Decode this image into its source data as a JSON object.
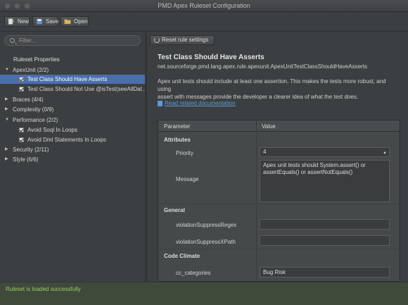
{
  "window": {
    "title": "PMD Apex Ruleset Configuration"
  },
  "toolbar": {
    "new_label": "New",
    "save_label": "Save",
    "open_label": "Open"
  },
  "sidebar": {
    "filter_placeholder": "Filter...",
    "tree_header": "Ruleset Properties",
    "items": [
      {
        "label": "ApexUnit (2/2)",
        "expanded": true
      },
      {
        "label": "Test Class Should Have Asserts",
        "checked": true,
        "selected": true
      },
      {
        "label": "Test Class Should Not Use @isTest(seeAllDat…",
        "checked": true
      },
      {
        "label": "Braces (4/4)",
        "expanded": false
      },
      {
        "label": "Complexity (0/9)",
        "expanded": false
      },
      {
        "label": "Performance (2/2)",
        "expanded": true
      },
      {
        "label": "Avoid Soql In Loops",
        "checked": true
      },
      {
        "label": "Avoid Dml Statements In Loops",
        "checked": true
      },
      {
        "label": "Security (2/11)",
        "expanded": false
      },
      {
        "label": "Style (6/6)",
        "expanded": false
      }
    ]
  },
  "detail": {
    "reset_label": "Reset rule settings",
    "rule_title": "Test Class Should Have Asserts",
    "rule_class": "net.sourceforge.pmd.lang.apex.rule.apexunit.ApexUnitTestClassShouldHaveAsserts",
    "description_line1": "Apex unit tests should include at least one assertion. This makes the tests more robust, and using",
    "description_line2": "assert with messages provide the developer a clearer idea of what the test does.",
    "doc_link": "Read related documentation"
  },
  "params": {
    "col_parameter": "Parameter",
    "col_value": "Value",
    "sections": {
      "attributes": "Attributes",
      "general": "General",
      "code_climate": "Code Climate"
    },
    "priority_label": "Priority",
    "priority_value": "4",
    "message_label": "Message",
    "message_line1": "Apex unit tests should System.assert() or",
    "message_line2": "assertEquals() or assertNotEquals()",
    "vsr_label": "violationSuppressRegex",
    "vsr_value": "",
    "vsx_label": "violationSuppressXPath",
    "vsx_value": "",
    "cc_label": "cc_categories",
    "cc_value": "Bug Risk"
  },
  "status": {
    "message": "Ruleset is loaded successfully"
  },
  "colors": {
    "selection": "#4b6eaf",
    "link": "#5b9bd5",
    "status_text": "#9ccc65"
  }
}
